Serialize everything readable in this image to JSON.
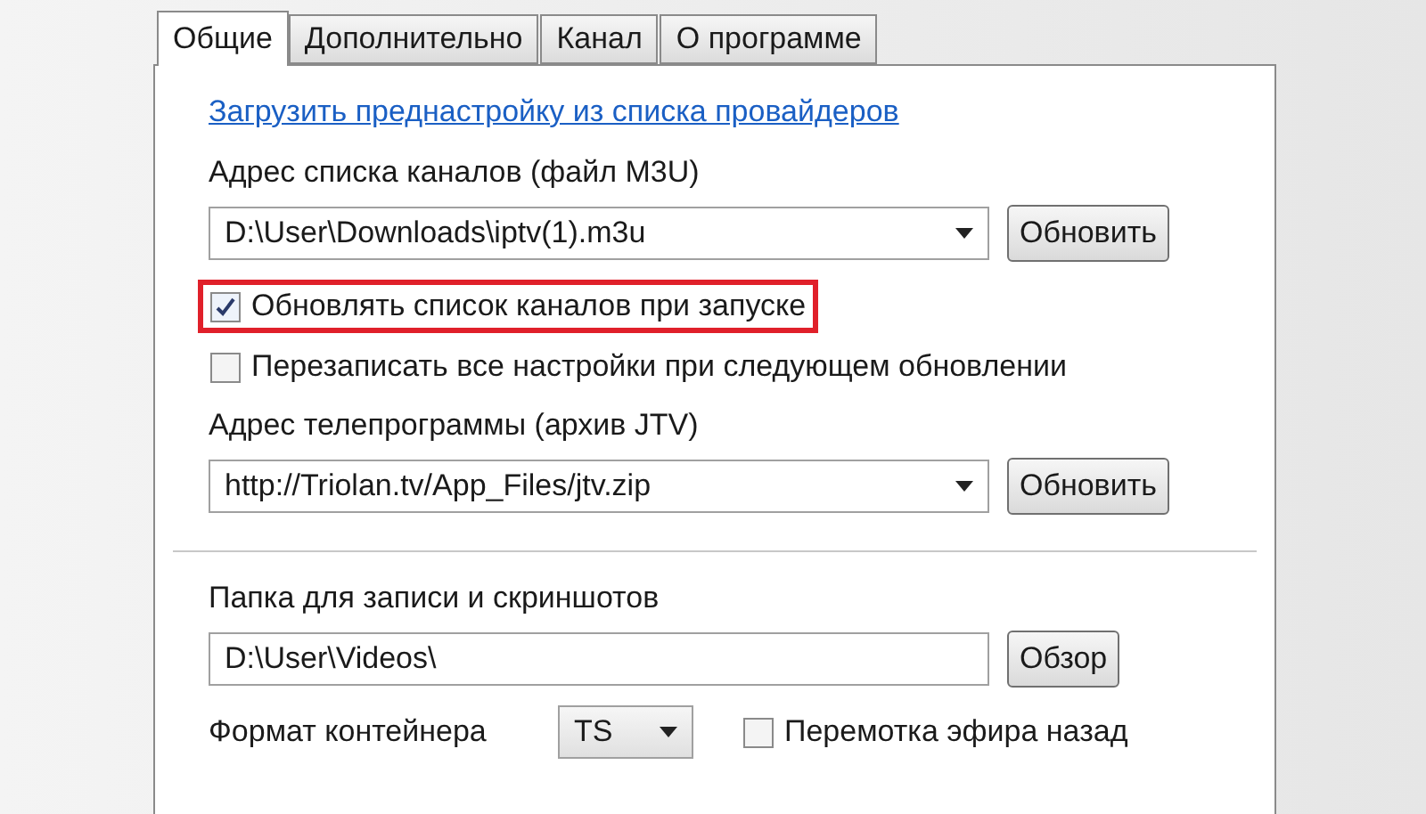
{
  "tabs": [
    {
      "label": "Общие",
      "selected": true
    },
    {
      "label": "Дополнительно",
      "selected": false
    },
    {
      "label": "Канал",
      "selected": false
    },
    {
      "label": "О программе",
      "selected": false
    }
  ],
  "preset_link": "Загрузить преднастройку из списка провайдеров",
  "playlist": {
    "label": "Адрес списка каналов (файл M3U)",
    "value": "D:\\User\\Downloads\\iptv(1).m3u",
    "button": "Обновить"
  },
  "options": [
    {
      "label": "Обновлять список каналов при запуске",
      "checked": true,
      "highlighted": true
    },
    {
      "label": "Перезаписать все настройки при следующем обновлении",
      "checked": false,
      "highlighted": false
    }
  ],
  "epg": {
    "label": "Адрес телепрограммы (архив JTV)",
    "value": "http://Triolan.tv/App_Files/jtv.zip",
    "button": "Обновить"
  },
  "record": {
    "label": "Папка для записи и скриншотов",
    "value": "D:\\User\\Videos\\",
    "button": "Обзор"
  },
  "format": {
    "label": "Формат контейнера",
    "value": "TS"
  },
  "rewind": {
    "label": "Перемотка эфира назад",
    "checked": false
  }
}
